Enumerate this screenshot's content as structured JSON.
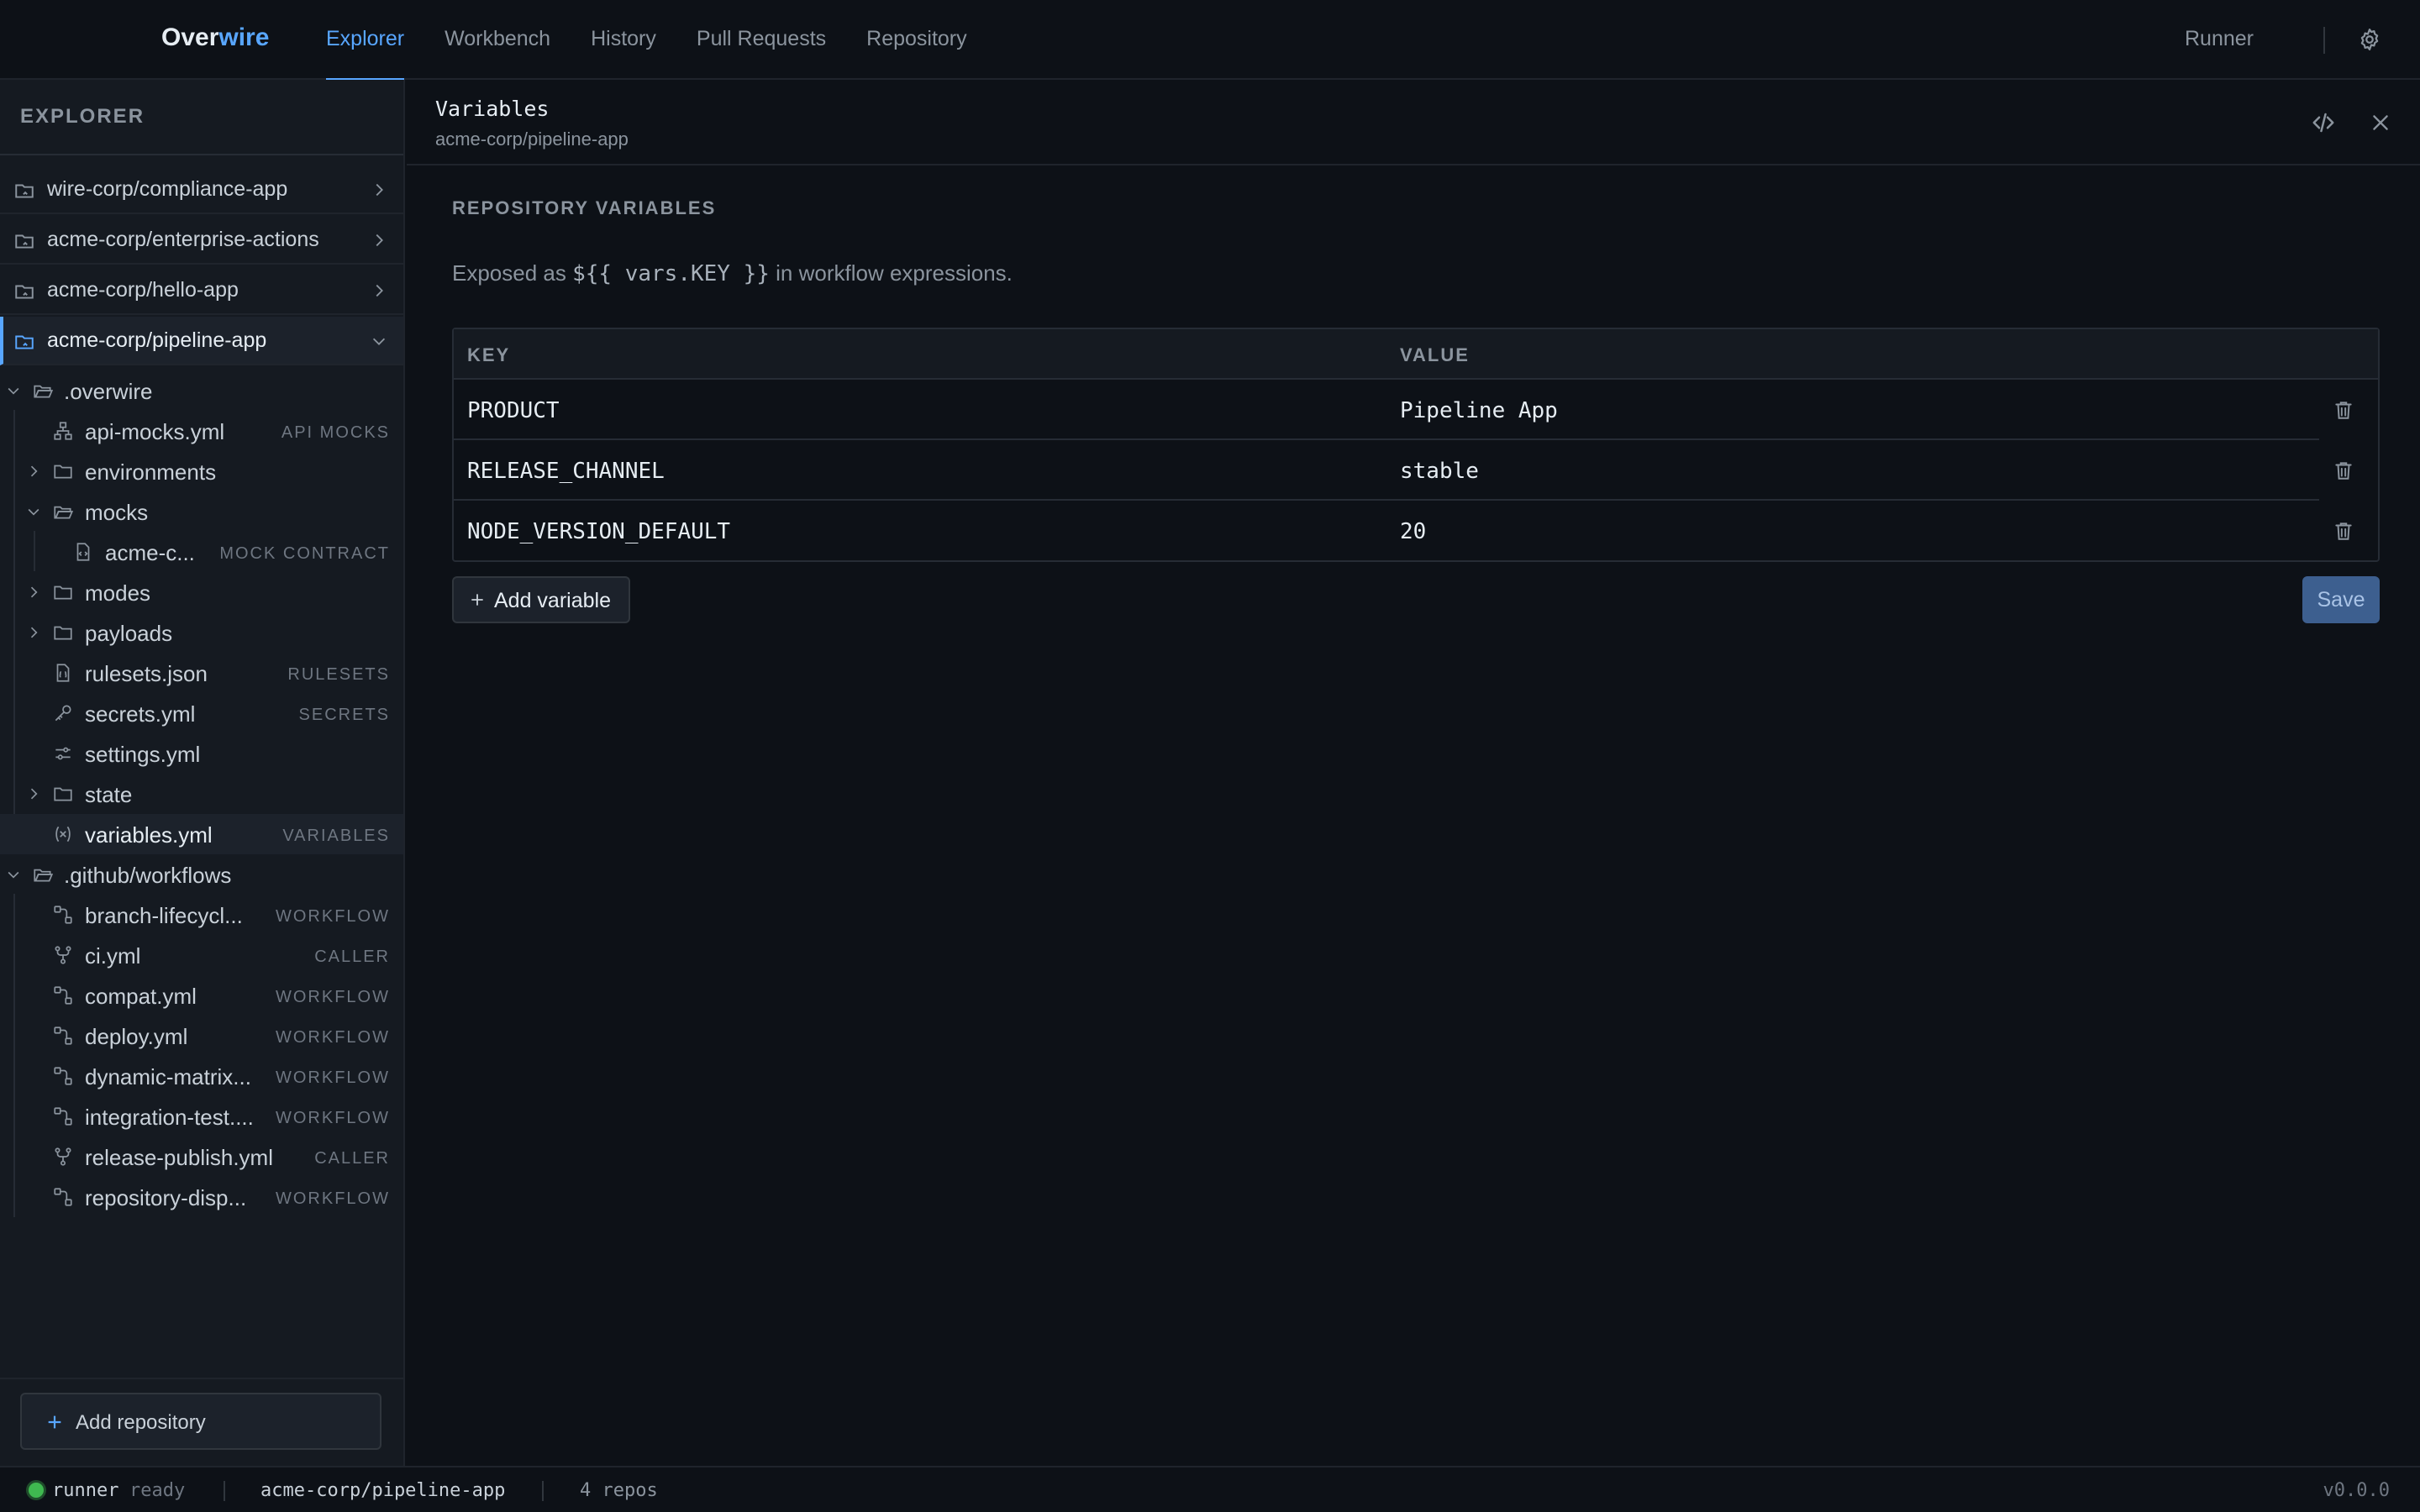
{
  "app": {
    "brand_prefix": "Over",
    "brand_suffix": "wire",
    "accent": "#58a6ff"
  },
  "nav": {
    "tabs": [
      {
        "label": "Explorer",
        "active": true
      },
      {
        "label": "Workbench"
      },
      {
        "label": "History"
      },
      {
        "label": "Pull Requests"
      },
      {
        "label": "Repository"
      }
    ],
    "runner": "Runner",
    "settings_icon": "gear-icon"
  },
  "sidebar": {
    "title": "EXPLORER",
    "repos": [
      {
        "label": "wire-corp/compliance-app"
      },
      {
        "label": "acme-corp/enterprise-actions"
      },
      {
        "label": "acme-corp/hello-app"
      },
      {
        "label": "acme-corp/pipeline-app",
        "expanded": true
      }
    ],
    "tree": [
      {
        "label": ".overwire",
        "type": "folder-open"
      },
      {
        "label": "api-mocks.yml",
        "badge": "API MOCKS",
        "icon": "sitemap-icon"
      },
      {
        "label": "environments",
        "type": "folder"
      },
      {
        "label": "mocks",
        "type": "folder-open"
      },
      {
        "label": "acme-c...",
        "badge": "MOCK CONTRACT",
        "icon": "file-code-icon"
      },
      {
        "label": "modes",
        "type": "folder"
      },
      {
        "label": "payloads",
        "type": "folder"
      },
      {
        "label": "rulesets.json",
        "badge": "RULESETS",
        "icon": "file-json-icon"
      },
      {
        "label": "secrets.yml",
        "badge": "SECRETS",
        "icon": "key-icon"
      },
      {
        "label": "settings.yml",
        "icon": "sliders-icon"
      },
      {
        "label": "state",
        "type": "folder"
      },
      {
        "label": "variables.yml",
        "badge": "VARIABLES",
        "icon": "variable-icon",
        "selected": true
      },
      {
        "label": ".github/workflows",
        "type": "folder-open"
      },
      {
        "label": "branch-lifecycl...",
        "badge": "WORKFLOW",
        "icon": "workflow-icon"
      },
      {
        "label": "ci.yml",
        "badge": "CALLER",
        "icon": "git-fork-icon"
      },
      {
        "label": "compat.yml",
        "badge": "WORKFLOW",
        "icon": "workflow-icon"
      },
      {
        "label": "deploy.yml",
        "badge": "WORKFLOW",
        "icon": "workflow-icon"
      },
      {
        "label": "dynamic-matrix...",
        "badge": "WORKFLOW",
        "icon": "workflow-icon"
      },
      {
        "label": "integration-test....",
        "badge": "WORKFLOW",
        "icon": "workflow-icon"
      },
      {
        "label": "release-publish.yml",
        "badge": "CALLER",
        "icon": "git-fork-icon"
      },
      {
        "label": "repository-disp...",
        "badge": "WORKFLOW",
        "icon": "workflow-icon"
      }
    ],
    "add_repo": "Add repository"
  },
  "panel": {
    "title": "Variables",
    "subtitle": "acme-corp/pipeline-app",
    "section": "REPOSITORY VARIABLES",
    "desc_prefix": "Exposed as ",
    "desc_code": "${{ vars.KEY }}",
    "desc_suffix": " in workflow expressions.",
    "col_key": "KEY",
    "col_value": "VALUE",
    "rows": [
      {
        "key": "PRODUCT",
        "value": "Pipeline App"
      },
      {
        "key": "RELEASE_CHANNEL",
        "value": "stable"
      },
      {
        "key": "NODE_VERSION_DEFAULT",
        "value": "20"
      }
    ],
    "add_variable": "Add variable",
    "save": "Save"
  },
  "status": {
    "runner": "runner",
    "runner_state": "ready",
    "runner_color": "#3fb950",
    "repo": "acme-corp/pipeline-app",
    "repos": "4 repos",
    "version": "v0.0.0"
  }
}
